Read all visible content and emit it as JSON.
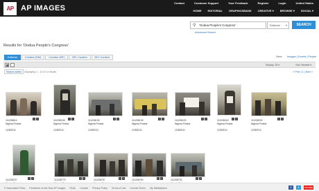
{
  "brand": {
    "logo_text": "AP",
    "name": "AP IMAGES"
  },
  "utility_nav": [
    "Contact",
    "Customer Support",
    "Your Feedback",
    "Register",
    "Login",
    "United States"
  ],
  "main_nav": [
    "HOME",
    "EDITORIAL",
    "GRAPHICSBANK",
    "CREATIVE ▾",
    "BROWSE ▾",
    "SOCIAL ▾"
  ],
  "search": {
    "query": "'Oodua People's Congress'",
    "filter": "Editorial",
    "button": "SEARCH",
    "advanced": "Advanced Search"
  },
  "results_title": "Results for 'Oodua People's Congress'",
  "view": {
    "label": "View:",
    "options": "Images | Events | People"
  },
  "tabs": [
    {
      "label": "Editorial",
      "active": true
    },
    {
      "label": "Creative (RM)",
      "active": false
    },
    {
      "label": "Creative (RF)",
      "active": false
    },
    {
      "label": "NFL Content",
      "active": false
    },
    {
      "label": "NFL Content",
      "active": false
    }
  ],
  "toolbar": {
    "display": "Display: 25 ▾",
    "sort": "Sort: Newest ▾"
  },
  "subbar": {
    "search_within": "Search within",
    "displaying": "Displaying 1 - 13 of 13 results",
    "pager": "« Prev | 1 | Next »"
  },
  "thumbnails": [
    {
      "id": "111208814",
      "title": "Nigeria Protest",
      "date": "12/8/2011"
    },
    {
      "id": "111208108",
      "title": "Nigeria Protest",
      "date": "12/8/2011"
    },
    {
      "id": "111208105",
      "title": "Nigeria Protest",
      "date": "12/8/2011"
    },
    {
      "id": "111208126",
      "title": "Nigeria Protest",
      "date": "12/8/2011"
    },
    {
      "id": "111208222",
      "title": "Nigeria Protest",
      "date": "12/8/2011"
    },
    {
      "id": "111208018",
      "title": "Nigeria Protest",
      "date": "12/8/2011"
    },
    {
      "id": "111208200",
      "title": "Nigeria Protest",
      "date": "12/8/2011"
    },
    {
      "id": "111208237",
      "title": "Nigeria Protest",
      "date": "12/8/2011"
    },
    {
      "id": "111208779",
      "title": "Nigeria Protest",
      "date": "12/8/2011"
    },
    {
      "id": "111208787",
      "title": "Nigeria Protest",
      "date": "12/8/2011"
    },
    {
      "id": "111208790",
      "title": "Nigeria Protest",
      "date": "12/8/2011"
    },
    {
      "id": "111208793",
      "title": "Nigeria Protest",
      "date": "12/8/2011"
    },
    {
      "id": "111208795",
      "title": "Nigeria Protest",
      "date": "12/8/2011"
    }
  ],
  "footer": {
    "links": [
      "© Associated Press",
      "Feedback on the New AP Images",
      "FAQs",
      "Contact",
      "Privacy Policy",
      "Terms of Use",
      "License Terms",
      "My Marketplace"
    ],
    "social": [
      "f",
      "t",
      "YouTube"
    ]
  },
  "colors": {
    "topbar": "#1a1a1a",
    "accent": "#2f8fd6",
    "logo_red": "#c8102e"
  },
  "icons": [
    "search-icon",
    "grid-view-icon",
    "list-view-icon",
    "lightbox-icon",
    "add-icon",
    "facebook-icon",
    "twitter-icon",
    "youtube-icon"
  ]
}
